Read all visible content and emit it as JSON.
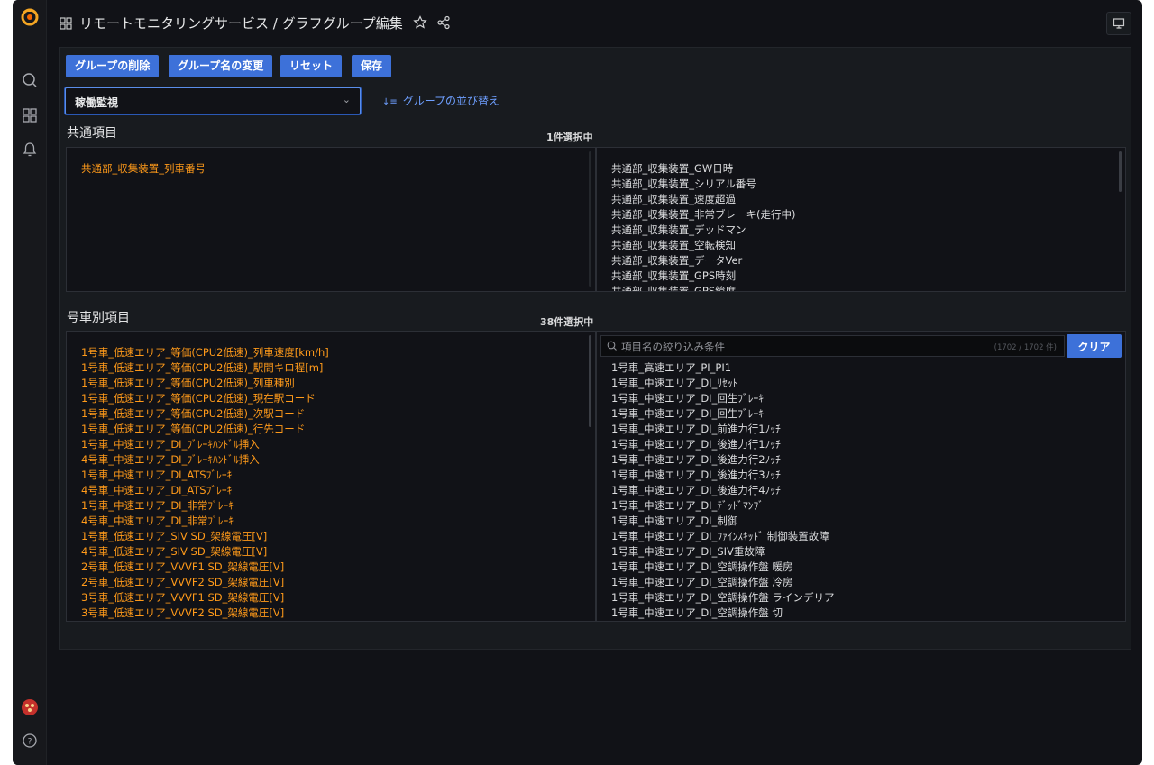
{
  "header": {
    "title": "リモートモニタリングサービス / グラフグループ編集"
  },
  "toolbar": {
    "delete_group": "グループの削除",
    "rename_group": "グループ名の変更",
    "reset": "リセット",
    "save": "保存"
  },
  "group_select": {
    "value": "稼働監視"
  },
  "sort_link": "グループの並び替え",
  "common": {
    "title": "共通項目",
    "count": "1件選択中",
    "selected": [
      "共通部_収集装置_列車番号"
    ],
    "available": [
      "共通部_収集装置_GW日時",
      "共通部_収集装置_シリアル番号",
      "共通部_収集装置_速度超過",
      "共通部_収集装置_非常ブレーキ(走行中)",
      "共通部_収集装置_デッドマン",
      "共通部_収集装置_空転検知",
      "共通部_収集装置_データVer",
      "共通部_収集装置_GPS時刻",
      "共通部_収集装置_GPS緯度"
    ]
  },
  "per_car": {
    "title": "号車別項目",
    "count": "38件選択中",
    "search_placeholder": "項目名の絞り込み条件",
    "search_count": "(1702 / 1702 件)",
    "clear_label": "クリア",
    "selected": [
      "1号車_低速エリア_等価(CPU2低速)_列車速度[km/h]",
      "1号車_低速エリア_等価(CPU2低速)_駅間キロ程[m]",
      "1号車_低速エリア_等価(CPU2低速)_列車種別",
      "1号車_低速エリア_等価(CPU2低速)_現在駅コード",
      "1号車_低速エリア_等価(CPU2低速)_次駅コード",
      "1号車_低速エリア_等価(CPU2低速)_行先コード",
      "1号車_中速エリア_DI_ﾌﾞﾚｰｷﾊﾝﾄﾞﾙ挿入",
      "4号車_中速エリア_DI_ﾌﾞﾚｰｷﾊﾝﾄﾞﾙ挿入",
      "1号車_中速エリア_DI_ATSﾌﾞﾚｰｷ",
      "4号車_中速エリア_DI_ATSﾌﾞﾚｰｷ",
      "1号車_中速エリア_DI_非常ﾌﾞﾚｰｷ",
      "4号車_中速エリア_DI_非常ﾌﾞﾚｰｷ",
      "1号車_低速エリア_SIV SD_架線電圧[V]",
      "4号車_低速エリア_SIV SD_架線電圧[V]",
      "2号車_低速エリア_VVVF1 SD_架線電圧[V]",
      "2号車_低速エリア_VVVF2 SD_架線電圧[V]",
      "3号車_低速エリア_VVVF1 SD_架線電圧[V]",
      "3号車_低速エリア_VVVF2 SD_架線電圧[V]"
    ],
    "available": [
      "1号車_高速エリア_PI_PI1",
      "1号車_中速エリア_DI_ﾘｾｯﾄ",
      "1号車_中速エリア_DI_回生ﾌﾞﾚｰｷ",
      "1号車_中速エリア_DI_回生ﾌﾞﾚｰｷ",
      "1号車_中速エリア_DI_前進力行1ﾉｯﾁ",
      "1号車_中速エリア_DI_後進力行1ﾉｯﾁ",
      "1号車_中速エリア_DI_後進力行2ﾉｯﾁ",
      "1号車_中速エリア_DI_後進力行3ﾉｯﾁ",
      "1号車_中速エリア_DI_後進力行4ﾉｯﾁ",
      "1号車_中速エリア_DI_ﾃﾞｯﾄﾞﾏﾝﾌﾞ",
      "1号車_中速エリア_DI_制御",
      "1号車_中速エリア_DI_ﾌｧｲﾝｽｷｯﾄﾞ 制御装置故障",
      "1号車_中速エリア_DI_SIV重故障",
      "1号車_中速エリア_DI_空調操作盤 暖房",
      "1号車_中速エリア_DI_空調操作盤 冷房",
      "1号車_中速エリア_DI_空調操作盤 ラインデリア",
      "1号車_中速エリア_DI_空調操作盤 切"
    ]
  }
}
